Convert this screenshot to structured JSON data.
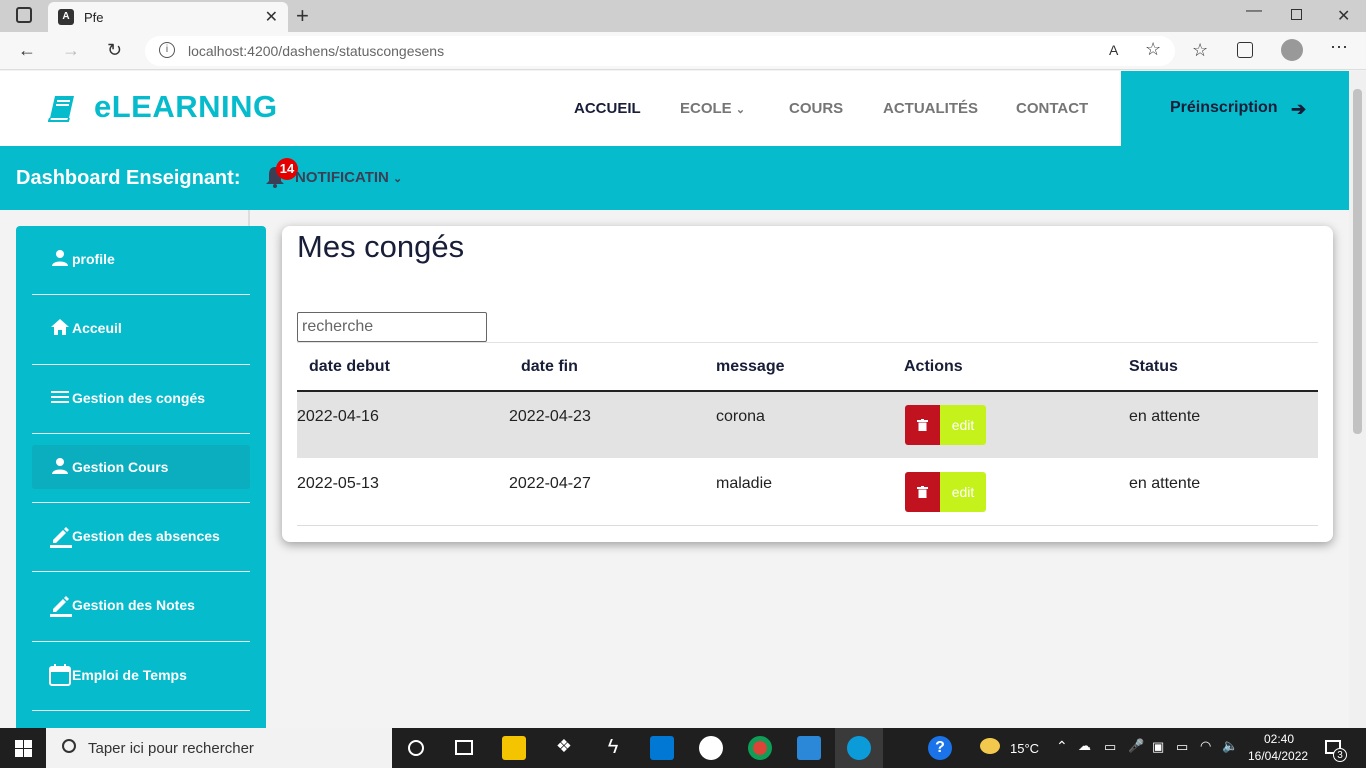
{
  "browser": {
    "tab_title": "Pfe",
    "url_host": "localhost",
    "url_path": ":4200/dashens/statuscongesens"
  },
  "header": {
    "logo": "eLEARNING",
    "menu": [
      "ACCUEIL",
      "ECOLE",
      "COURS",
      "ACTUALITÉS",
      "CONTACT"
    ],
    "cta": "Préinscription"
  },
  "dashbar": {
    "title": "Dashboard Enseignant:",
    "badge_count": "14",
    "notification_label": "NOTIFICATIN"
  },
  "sidebar": {
    "items": [
      {
        "label": "profile",
        "icon": "person-icon"
      },
      {
        "label": "Acceuil",
        "icon": "home-icon"
      },
      {
        "label": "Gestion des congés",
        "icon": "menu-icon"
      },
      {
        "label": "Gestion Cours",
        "icon": "person-icon"
      },
      {
        "label": "Gestion des absences",
        "icon": "pencil-icon"
      },
      {
        "label": "Gestion des Notes",
        "icon": "pencil-icon"
      },
      {
        "label": "Emploi de Temps",
        "icon": "calendar-icon"
      }
    ]
  },
  "main": {
    "title": "Mes congés",
    "search_placeholder": "recherche",
    "columns": [
      "date debut",
      "date fin",
      "message",
      "Actions",
      "Status"
    ],
    "rows": [
      {
        "date_debut": "2022-04-16",
        "date_fin": "2022-04-23",
        "message": "corona",
        "status": "en attente"
      },
      {
        "date_debut": "2022-05-13",
        "date_fin": "2022-04-27",
        "message": "maladie",
        "status": "en attente"
      }
    ],
    "edit_label": "edit"
  },
  "taskbar": {
    "search_text": "Taper ici pour rechercher",
    "temperature": "15°C",
    "time": "02:40",
    "date": "16/04/2022",
    "notification_count": "3"
  },
  "colors": {
    "accent": "#06bbcc",
    "dark": "#181d38",
    "delete": "#c1121f",
    "edit": "#c6f21c",
    "badge": "#e40000"
  }
}
